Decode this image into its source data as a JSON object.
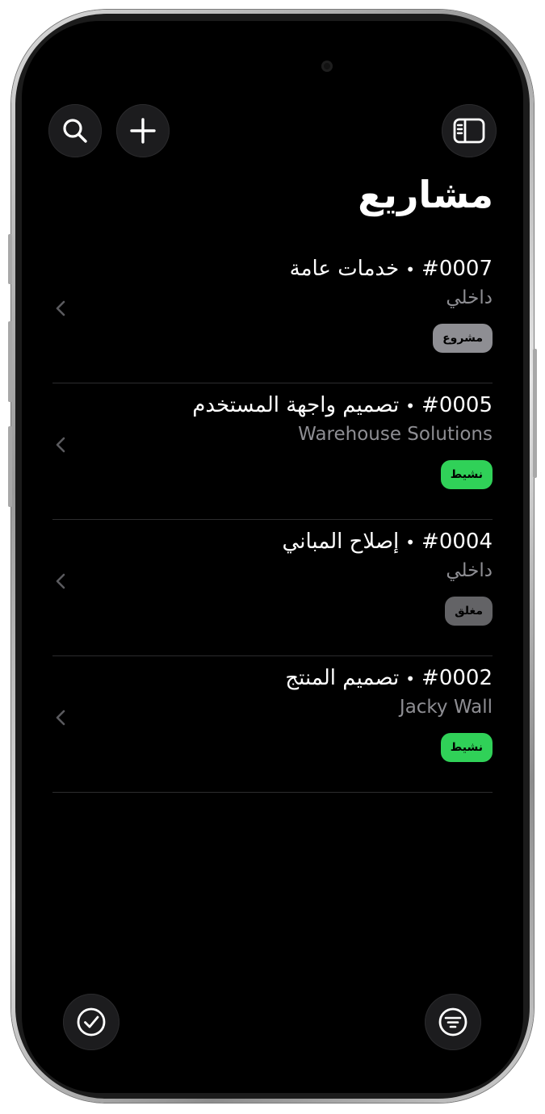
{
  "header": {
    "title": "مشاريع"
  },
  "toolbar": {
    "search_icon": "magnifying-glass",
    "add_icon": "plus",
    "sidebar_icon": "sidebar-left"
  },
  "projects": [
    {
      "id": "#0007",
      "separator": "•",
      "name": "خدمات عامة",
      "client": "داخلي",
      "status": "مشروع",
      "status_color": "#8e8e93"
    },
    {
      "id": "#0005",
      "separator": "•",
      "name": "تصميم واجهة المستخدم",
      "client": "Warehouse Solutions",
      "status": "نشيط",
      "status_color": "#30d158"
    },
    {
      "id": "#0004",
      "separator": "•",
      "name": "إصلاح المباني",
      "client": "داخلي",
      "status": "مغلق",
      "status_color": "#636366"
    },
    {
      "id": "#0002",
      "separator": "•",
      "name": "تصميم المنتج",
      "client": "Jacky Wall",
      "status": "نشيط",
      "status_color": "#30d158"
    }
  ],
  "bottom_bar": {
    "select_icon": "checkmark-circle",
    "filter_icon": "filter-lines-circle"
  },
  "colors": {
    "background": "#000000",
    "button_bg": "#1c1c1e",
    "active": "#30d158",
    "secondary_text": "#8e8e93"
  }
}
